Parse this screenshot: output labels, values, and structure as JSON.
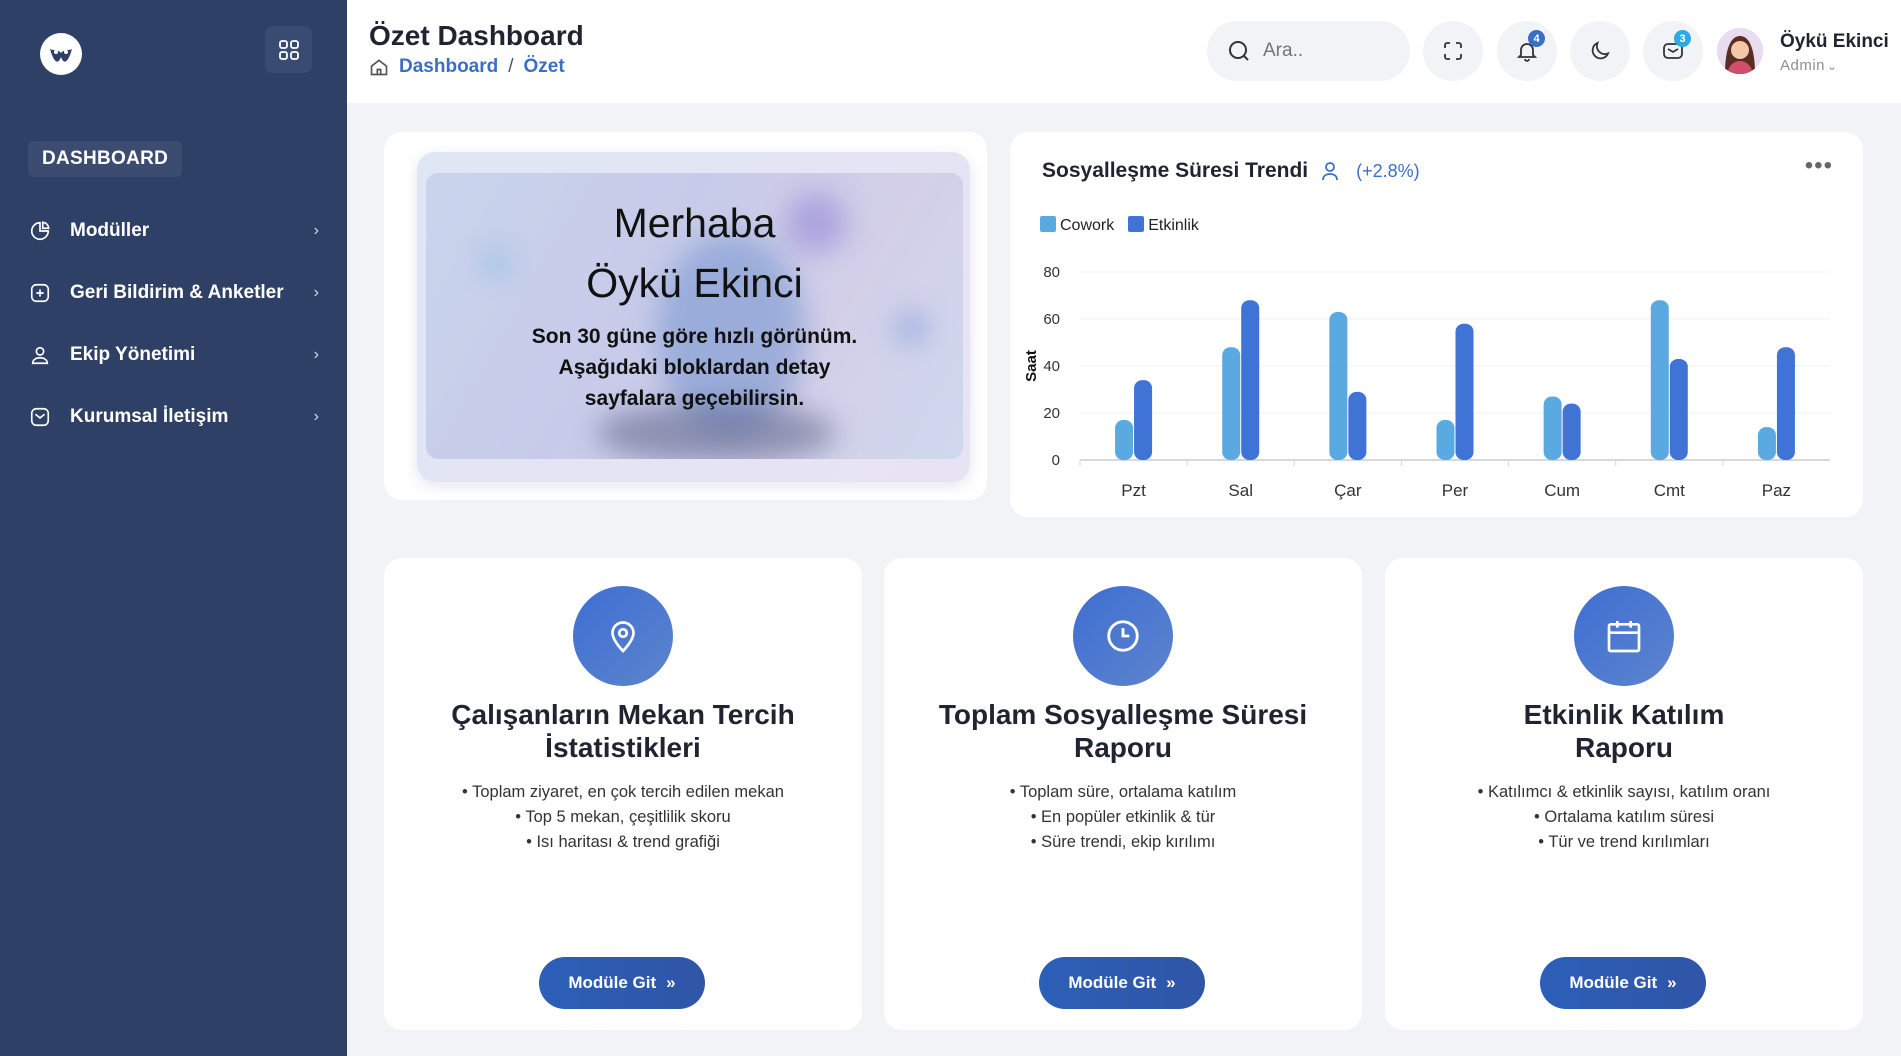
{
  "sidebar": {
    "section": "DASHBOARD",
    "items": [
      {
        "label": "Modüller",
        "icon": "pie-chart-icon"
      },
      {
        "label": "Geri Bildirim & Anketler",
        "icon": "plus-square-icon"
      },
      {
        "label": "Ekip Yönetimi",
        "icon": "user-icon"
      },
      {
        "label": "Kurumsal İletişim",
        "icon": "mail-icon"
      }
    ]
  },
  "header": {
    "title": "Özet Dashboard",
    "breadcrumb": [
      "Dashboard",
      "Özet"
    ],
    "search_placeholder": "Ara..",
    "notification_count": "4",
    "mail_count": "3",
    "user_name": "Öykü Ekinci",
    "user_role": "Admin"
  },
  "welcome": {
    "greeting_line1": "Merhaba",
    "greeting_line2": "Öykü Ekinci",
    "subtitle": "Son 30 güne göre hızlı görünüm. Aşağıdaki bloklardan detay sayfalara geçebilirsin."
  },
  "trend": {
    "title": "Sosyalleşme Süresi Trendi",
    "change": "(+2.8%)"
  },
  "chart_data": {
    "type": "bar",
    "title": "Sosyalleşme Süresi Trendi",
    "xlabel": "",
    "ylabel": "Saat",
    "ylim": [
      0,
      80
    ],
    "yticks": [
      0,
      20,
      40,
      60,
      80
    ],
    "grid": true,
    "legend_position": "top-left",
    "categories": [
      "Pzt",
      "Sal",
      "Çar",
      "Per",
      "Cum",
      "Cmt",
      "Paz"
    ],
    "series": [
      {
        "name": "Cowork",
        "color": "#5aa9e0",
        "values": [
          17,
          48,
          63,
          17,
          27,
          68,
          14
        ]
      },
      {
        "name": "Etkinlik",
        "color": "#3f73d6",
        "values": [
          34,
          68,
          29,
          58,
          24,
          43,
          48
        ]
      }
    ]
  },
  "modules": [
    {
      "title": "Çalışanların Mekan Tercih İstatistikleri",
      "icon": "map-pin-icon",
      "bullets": [
        "• Toplam ziyaret, en çok tercih edilen mekan",
        "• Top 5 mekan, çeşitlilik skoru",
        "• Isı haritası & trend grafiği"
      ],
      "button": "Modüle Git"
    },
    {
      "title": "Toplam Sosyalleşme Süresi Raporu",
      "icon": "clock-icon",
      "bullets": [
        "• Toplam süre, ortalama katılım",
        "• En popüler etkinlik & tür",
        "• Süre trendi, ekip kırılımı"
      ],
      "button": "Modüle Git"
    },
    {
      "title": "Etkinlik Katılım Raporu",
      "icon": "calendar-icon",
      "bullets": [
        "• Katılımcı & etkinlik sayısı, katılım oranı",
        "• Ortalama katılım süresi",
        "• Tür ve trend kırılımları"
      ],
      "button": "Modüle Git"
    }
  ]
}
